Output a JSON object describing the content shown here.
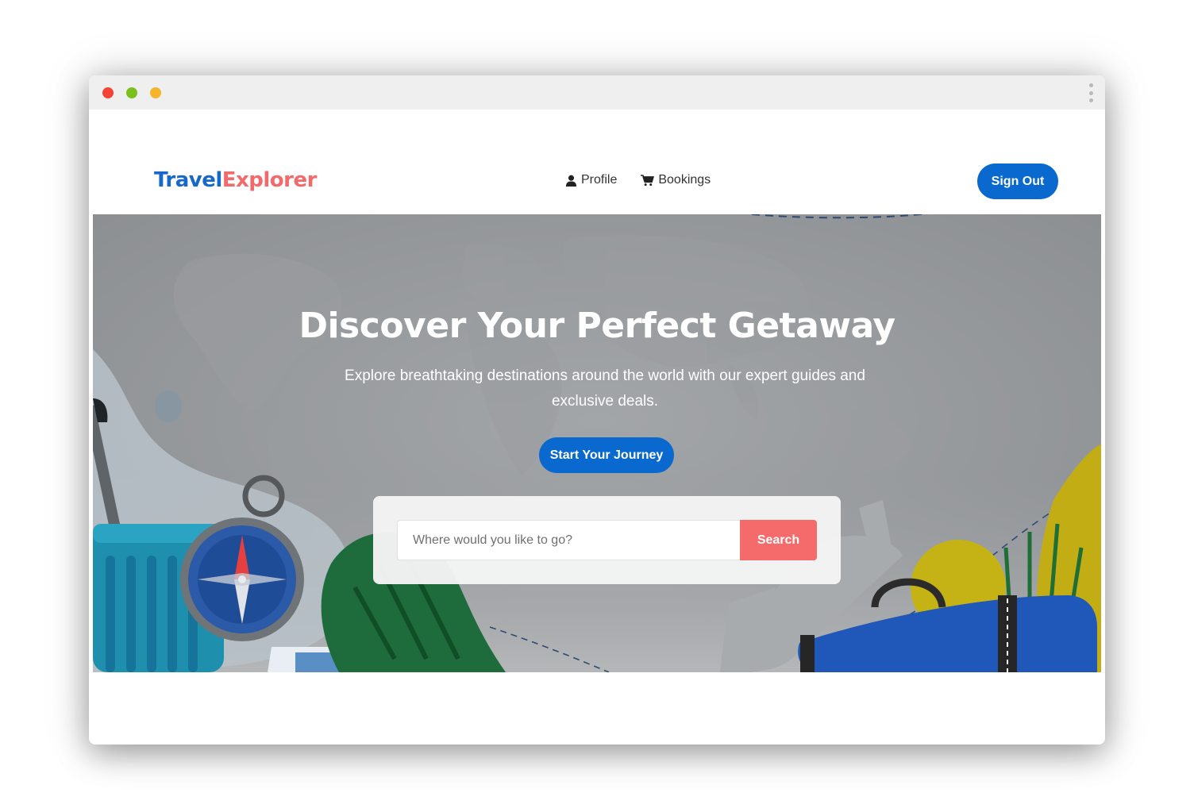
{
  "window": {
    "controls": {
      "close_color": "#f44336",
      "minimize_color": "#7cc01e",
      "maximize_color": "#f5b52b"
    },
    "menu_icon": "kebab-menu-icon"
  },
  "navbar": {
    "logo": {
      "part1": "Travel",
      "part2": "Explorer",
      "color1": "#1769c9",
      "color2": "#f26a6a"
    },
    "links": [
      {
        "label": "Profile",
        "icon": "user-icon"
      },
      {
        "label": "Bookings",
        "icon": "cart-icon"
      }
    ],
    "sign_out_label": "Sign Out"
  },
  "hero": {
    "title": "Discover Your Perfect Getaway",
    "subtitle": "Explore breathtaking destinations around the world with our expert guides and exclusive deals.",
    "cta_label": "Start Your Journey",
    "search": {
      "placeholder": "Where would you like to go?",
      "value": "",
      "button_label": "Search"
    }
  },
  "colors": {
    "primary": "#0969cf",
    "accent": "#f56a6a",
    "hero_overlay": "#909395"
  }
}
